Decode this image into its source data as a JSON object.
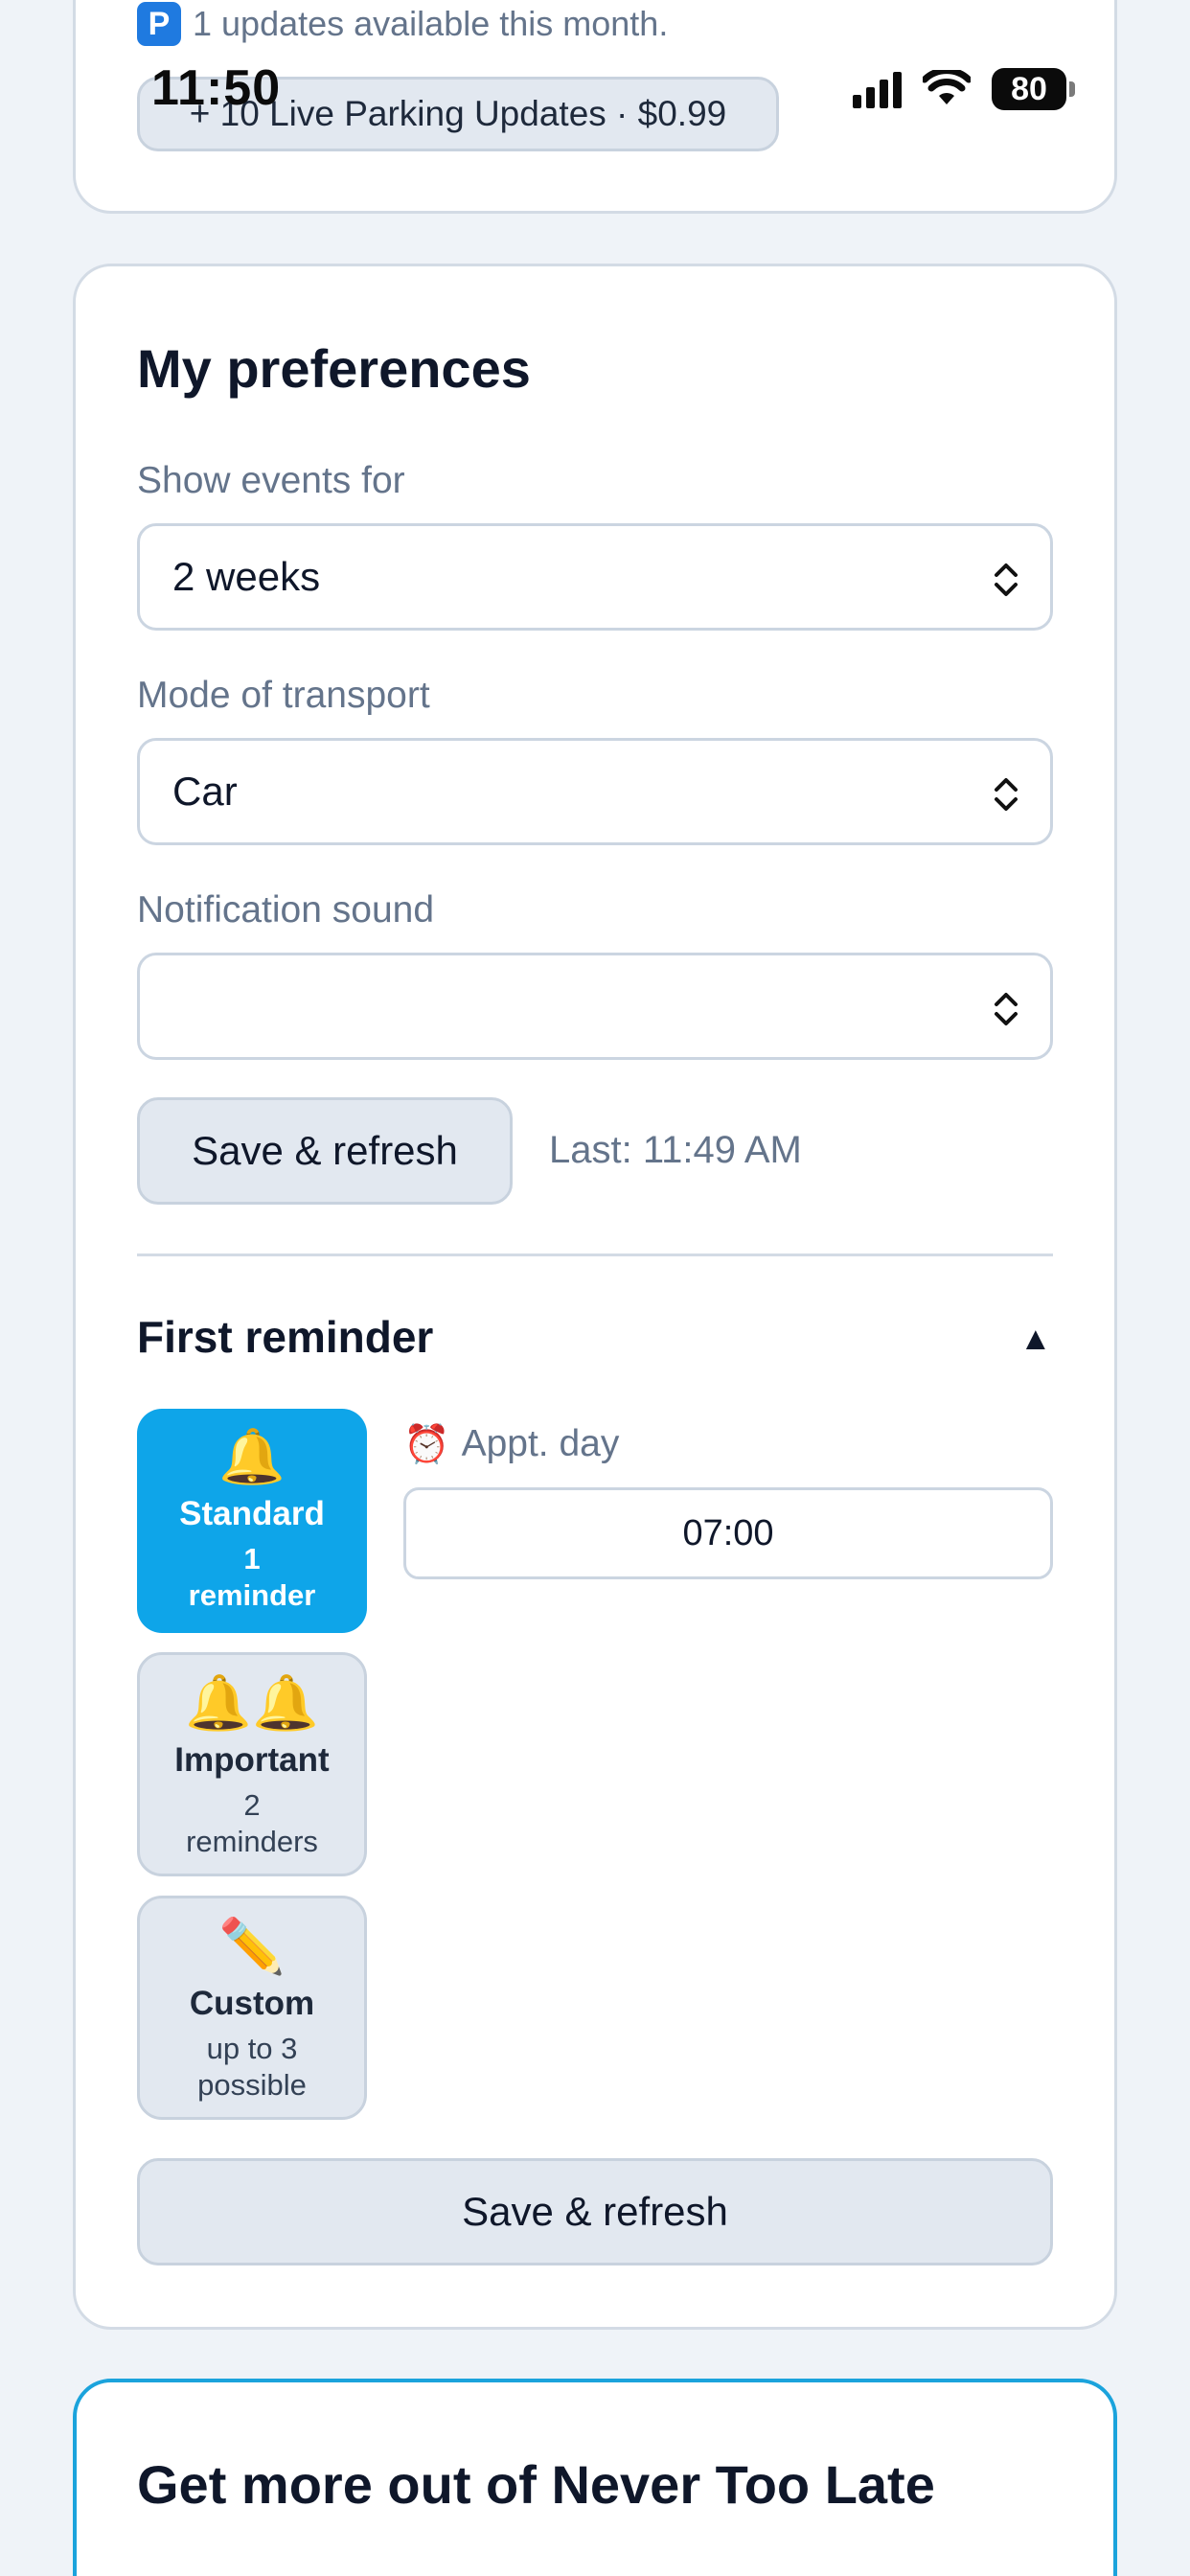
{
  "status_bar": {
    "time": "11:50",
    "battery": "80"
  },
  "top_card": {
    "updates_text": "1 updates available this month.",
    "parking_icon_letter": "P",
    "parking_pill": "+ 10 Live Parking Updates · $0.99"
  },
  "preferences": {
    "title": "My preferences",
    "show_events": {
      "label": "Show events for",
      "value": "2 weeks"
    },
    "transport": {
      "label": "Mode of transport",
      "value": "Car"
    },
    "sound": {
      "label": "Notification sound",
      "value": ""
    },
    "save_label": "Save & refresh",
    "last_saved": "Last: 11:49 AM"
  },
  "reminder": {
    "title": "First reminder",
    "collapse_glyph": "▲",
    "tiles": [
      {
        "emoji": "🔔",
        "name": "Standard",
        "sub1": "1",
        "sub2": "reminder"
      },
      {
        "emoji": "🔔🔔",
        "name": "Important",
        "sub1": "2",
        "sub2": "reminders"
      },
      {
        "emoji": "✏️",
        "name": "Custom",
        "sub1": "up to 3",
        "sub2": "possible"
      }
    ],
    "appt_emoji": "⏰",
    "appt_label": "Appt. day",
    "appt_time": "07:00",
    "save_label": "Save & refresh"
  },
  "more_card": {
    "title": "Get more out of Never Too Late"
  },
  "icons": [
    "signal-icon",
    "wifi-icon",
    "battery-icon",
    "parking-icon",
    "chevron-updown-icon",
    "bell-icon",
    "pencil-icon",
    "alarm-clock-icon"
  ],
  "colors": {
    "accent": "#0ea5e9",
    "accent_border": "#1ba3dc",
    "background": "#eff3f8"
  }
}
